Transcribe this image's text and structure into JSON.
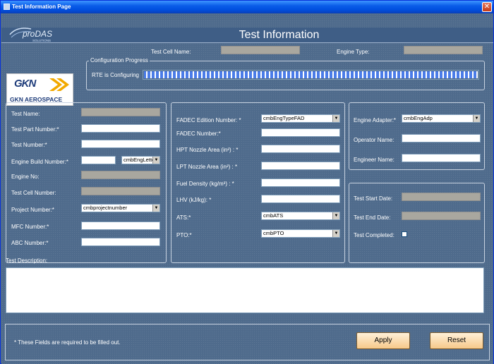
{
  "window": {
    "title": "Test Information Page",
    "close_glyph": "✕"
  },
  "header": {
    "title": "Test Information",
    "logo_text": "proDAS",
    "logo_sub": "SOLUTIONS"
  },
  "top_fields": {
    "test_cell_name_label": "Test Cell Name:",
    "engine_type_label": "Engine Type:"
  },
  "brand": {
    "gkn_word": "GKN",
    "gkn_sub": "GKN AEROSPACE"
  },
  "config": {
    "group_title": "Configuration Progress",
    "rte_label": "RTE is Configuring"
  },
  "left_panel": {
    "test_name": "Test Name:",
    "test_part_number": "Test Part Number:*",
    "test_number": "Test Number:*",
    "engine_build_number": "Engine Build Number:*",
    "engine_build_combo": "cmbEngLetter",
    "engine_no": "Engine No:",
    "test_cell_number": "Test Cell Number:",
    "project_number": "Project Number:*",
    "project_combo": "cmbprojectnumber",
    "mfc_number": "MFC Number:*",
    "abc_number": "ABC Number:*"
  },
  "middle_panel": {
    "fadec_edition": "FADEC Edition Number: *",
    "fadec_edition_combo": "cmbEngTypeFAD",
    "fadec_number": "FADEC Number:*",
    "hpt_nozzle": "HPT Nozzle Area (in²) : *",
    "lpt_nozzle": "LPT Nozzle Area (in²) : *",
    "fuel_density": "Fuel Density (kg/m³) : *",
    "lhv": "LHV (kJ/kg): *",
    "ats": "ATS:*",
    "ats_combo": "cmbATS",
    "pto": "PTO:*",
    "pto_combo": "cmbPTO"
  },
  "right_top_panel": {
    "engine_adapter": "Engine Adapter:*",
    "engine_adapter_combo": "cmbEngAdp",
    "operator_name": "Operator Name:",
    "engineer_name": "Engineer Name:"
  },
  "right_bottom_panel": {
    "test_start_date": "Test Start Date:",
    "test_end_date": "Test End Date:",
    "test_completed": "Test Completed:"
  },
  "description": {
    "label": "Test Description:"
  },
  "footer": {
    "note": "* These Fields are required to be filled out.",
    "apply_label": "Apply",
    "reset_label": "Reset"
  },
  "icons": {
    "combo_arrow": "chevron-down-icon"
  },
  "colors": {
    "background": "#4f6b8c",
    "title_bar": "#0a5ce8",
    "button": "#f7c98a"
  }
}
